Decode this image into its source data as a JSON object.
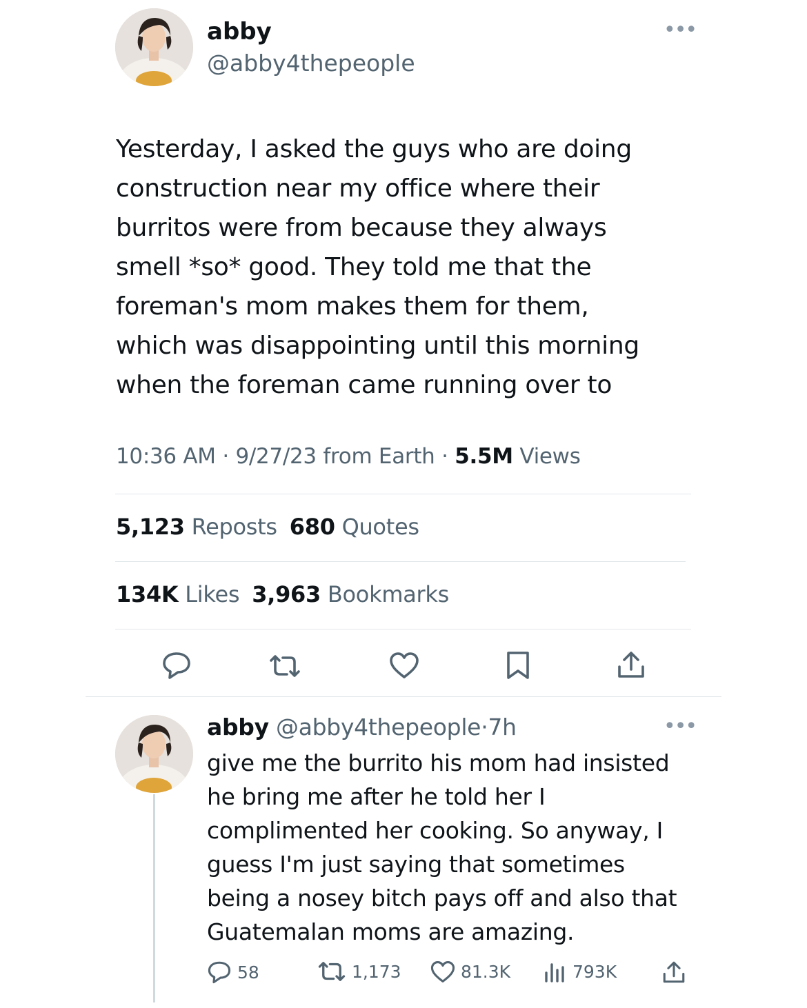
{
  "tweet": {
    "author": {
      "name": "abby",
      "handle": "@abby4thepeople"
    },
    "text": "Yesterday, I asked the guys who are doing\nconstruction near my office where their\nburritos were from because they always\nsmell *so* good. They told me that the\nforeman's mom makes them for them,\nwhich was disappointing until this morning\nwhen the foreman came running over to",
    "time": "10:36 AM",
    "date": "9/27/23",
    "source": "from Earth",
    "separator": "·",
    "views_count": "5.5M",
    "views_label": "Views",
    "reposts_count": "5,123",
    "reposts_label": "Reposts",
    "quotes_count": "680",
    "quotes_label": "Quotes",
    "likes_count": "134K",
    "likes_label": "Likes",
    "bookmarks_count": "3,963",
    "bookmarks_label": "Bookmarks",
    "actions": [
      "reply-icon",
      "repost-icon",
      "like-icon",
      "bookmark-icon",
      "share-icon"
    ]
  },
  "reply": {
    "author": {
      "name": "abby",
      "handle": "@abby4thepeople"
    },
    "time": "7h",
    "separator": "·",
    "text": "give me the burrito his mom had insisted\nhe bring me after he told her I\ncomplimented her cooking. So anyway, I\nguess I'm just saying that sometimes\nbeing a nosey bitch pays off and also that\nGuatemalan moms are amazing.",
    "replies": "58",
    "reposts": "1,173",
    "likes": "81.3K",
    "views": "793K"
  },
  "colors": {
    "text": "#0f1419",
    "muted": "#536471",
    "divider": "#e1e6ea",
    "thread_line": "#cfd9de"
  }
}
